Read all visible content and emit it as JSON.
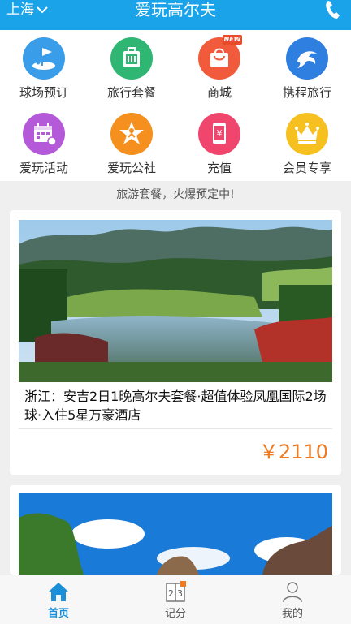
{
  "header": {
    "city": "上海",
    "title": "爱玩高尔夫"
  },
  "grid": [
    {
      "label": "球场预订",
      "icon": "golf-flag-icon",
      "color": "#3a9de9"
    },
    {
      "label": "旅行套餐",
      "icon": "luggage-icon",
      "color": "#2fb673"
    },
    {
      "label": "商城",
      "icon": "shopping-bag-icon",
      "color": "#f25a3c",
      "tag": "NEW"
    },
    {
      "label": "携程旅行",
      "icon": "dolphin-icon",
      "color": "#2f7fe0"
    },
    {
      "label": "爱玩活动",
      "icon": "calendar-icon",
      "color": "#b45ad8"
    },
    {
      "label": "爱玩公社",
      "icon": "star-figure-icon",
      "color": "#f5901e"
    },
    {
      "label": "充值",
      "icon": "phone-yuan-icon",
      "color": "#f0466e"
    },
    {
      "label": "会员专享",
      "icon": "crown-icon",
      "color": "#f5c020"
    }
  ],
  "banner": "旅游套餐，火爆预定中!",
  "cards": [
    {
      "title": "浙江：安吉2日1晚高尔夫套餐·超值体验凤凰国际2场球·入住5星万豪酒店",
      "price": "￥2110"
    }
  ],
  "tabs": [
    {
      "label": "首页",
      "icon": "home-icon",
      "active": true
    },
    {
      "label": "记分",
      "icon": "scorecard-icon",
      "active": false
    },
    {
      "label": "我的",
      "icon": "user-icon",
      "active": false
    }
  ]
}
